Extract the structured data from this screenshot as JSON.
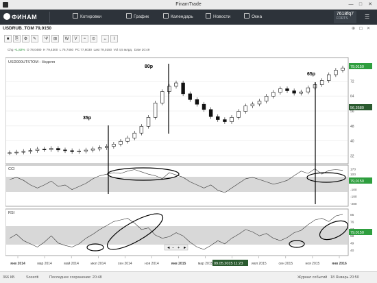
{
  "window": {
    "title": "FinamTrade",
    "minimize": "—",
    "maximize": "□",
    "close": "✕"
  },
  "toolbar": {
    "logo": "ФИНАМ",
    "items": [
      {
        "label": "Котировки",
        "icon": "quotes-icon"
      },
      {
        "label": "График",
        "icon": "chart-icon"
      },
      {
        "label": "Календарь",
        "icon": "calendar-icon"
      },
      {
        "label": "Новости",
        "icon": "news-icon"
      },
      {
        "label": "Окна",
        "icon": "windows-icon"
      }
    ],
    "account_number": "7618fq7",
    "account_sub": "FORTS"
  },
  "panel": {
    "title": "USDRUB_TOM 79,0150"
  },
  "tools": [
    "■",
    "⎘",
    "⚙",
    "✎",
    "Ψ",
    "⊞",
    "W",
    "V",
    "≈",
    "⊙",
    "↔",
    "I"
  ],
  "quote": {
    "chg_label": "Chg",
    "chg": "+1,82%",
    "o_label": "O",
    "o": "78,0480",
    "h_label": "H",
    "h": "79,4300",
    "l_label": "L",
    "l": "76,7450",
    "pc_label": "PC",
    "pc": "77,6030",
    "last_label": "Last",
    "last": "79,0150",
    "vol_label": "Vol",
    "vol": "4,5 млрд.",
    "date_label": "Date",
    "date": "20:49"
  },
  "chart_data": {
    "type": "line",
    "legend": "USD000UTSTOM - Неделя",
    "x_ticks": [
      "янв 2014",
      "мар 2014",
      "май 2014",
      "июл 2014",
      "сен 2014",
      "ноя 2014",
      "янв 2015",
      "мар 2015",
      "май 2015",
      "июл 2015",
      "сен 2015",
      "ноя 2015",
      "янв 2016"
    ],
    "price_ticks": [
      "72",
      "64",
      "56",
      "48",
      "40",
      "32"
    ],
    "price_last": "79,0150",
    "price_cursor": "56,3580",
    "annotations": [
      "35р",
      "80р",
      "65р"
    ],
    "cci_label": "CCI",
    "cci_ticks": [
      "170",
      "100",
      "0",
      "-100",
      "-190",
      "-280"
    ],
    "cci_last": "79,0150",
    "rsi_label": "RSI",
    "rsi_ticks": [
      "85",
      "76",
      "67",
      "58",
      "49",
      "40"
    ],
    "rsi_last": "79,0150",
    "cursor_date": "09.05.2015 11:23",
    "price_series": [
      33.7,
      34.0,
      34.4,
      34.9,
      35.6,
      35.4,
      36.0,
      35.2,
      34.8,
      34.3,
      34.6,
      35.1,
      35.8,
      36.4,
      37.1,
      38.3,
      39.8,
      41.6,
      44.2,
      47.8,
      52.6,
      60.3,
      66.4,
      69.2,
      71.0,
      65.2,
      62.1,
      59.6,
      56.8,
      53.0,
      51.4,
      50.3,
      52.6,
      55.8,
      58.7,
      59.7,
      61.3,
      63.9,
      66.0,
      67.9,
      66.8,
      65.5,
      66.2,
      68.4,
      70.1,
      72.3,
      75.4,
      77.8,
      79.0
    ],
    "cci_series": [
      30,
      60,
      20,
      -40,
      -80,
      -40,
      10,
      -60,
      -40,
      -100,
      -60,
      -20,
      40,
      80,
      100,
      120,
      110,
      140,
      160,
      130,
      100,
      80,
      40,
      120,
      90,
      60,
      0,
      -40,
      -80,
      -40,
      -110,
      -140,
      -80,
      -20,
      40,
      60,
      30,
      0,
      -30,
      -10,
      20,
      80,
      140,
      110,
      170,
      100,
      150,
      160,
      150
    ],
    "rsi_series": [
      55,
      60,
      52,
      48,
      44,
      50,
      58,
      49,
      46,
      44,
      48,
      55,
      60,
      66,
      71,
      76,
      78,
      80,
      74,
      66,
      68,
      59,
      55,
      57,
      62,
      58,
      50,
      44,
      41,
      46,
      52,
      48,
      55,
      60,
      66,
      63,
      58,
      61,
      55,
      52,
      56,
      62,
      65,
      72,
      78,
      80,
      76,
      83,
      85
    ]
  },
  "nav": {
    "prev": "◄",
    "minus": "−",
    "plus": "+",
    "next": "►"
  },
  "status": {
    "speed": "366 КБ",
    "server": "Soxeriti",
    "saved": "Последнее сохранение: 20:48",
    "journal": "Журнал событий",
    "datetime": "18 Январь 20:50"
  }
}
